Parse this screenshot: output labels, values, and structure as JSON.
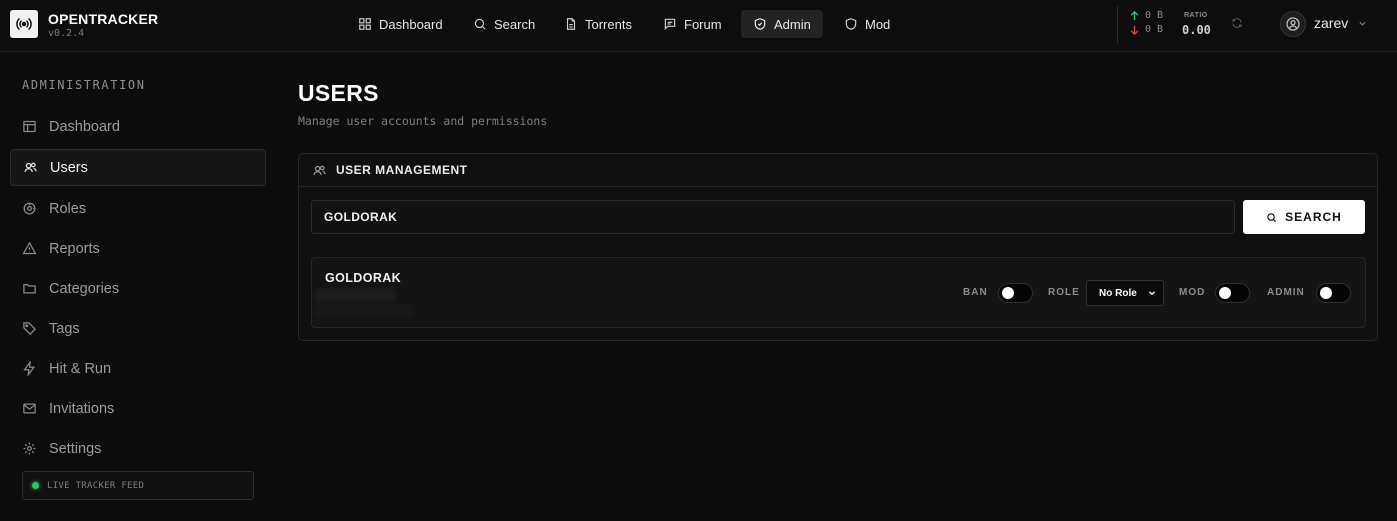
{
  "brand": {
    "name": "OPENTRACKER",
    "version": "v0.2.4"
  },
  "nav": {
    "dashboard": "Dashboard",
    "search": "Search",
    "torrents": "Torrents",
    "forum": "Forum",
    "admin": "Admin",
    "mod": "Mod"
  },
  "stats": {
    "upload": "0 B",
    "download": "0 B",
    "ratio_label": "RATIO",
    "ratio_value": "0.00"
  },
  "user": {
    "name": "zarev"
  },
  "sidebar": {
    "title": "ADMINISTRATION",
    "items": [
      {
        "label": "Dashboard",
        "icon": "layout-icon",
        "active": false
      },
      {
        "label": "Users",
        "icon": "users-icon",
        "active": true
      },
      {
        "label": "Roles",
        "icon": "badge-icon",
        "active": false
      },
      {
        "label": "Reports",
        "icon": "alert-icon",
        "active": false
      },
      {
        "label": "Categories",
        "icon": "folder-icon",
        "active": false
      },
      {
        "label": "Tags",
        "icon": "tag-icon",
        "active": false
      },
      {
        "label": "Hit & Run",
        "icon": "bolt-icon",
        "active": false
      },
      {
        "label": "Invitations",
        "icon": "mail-icon",
        "active": false
      },
      {
        "label": "Settings",
        "icon": "gear-icon",
        "active": false
      }
    ],
    "live_feed": "LIVE TRACKER FEED"
  },
  "page": {
    "title": "USERS",
    "subtitle": "Manage user accounts and permissions"
  },
  "panel": {
    "title": "USER MANAGEMENT",
    "search_value": "GOLDORAK",
    "search_button": "SEARCH",
    "result": {
      "username": "GOLDORAK",
      "ban_label": "BAN",
      "ban": false,
      "role_label": "ROLE",
      "role_value": "No Role",
      "mod_label": "MOD",
      "mod": false,
      "admin_label": "ADMIN",
      "admin": false
    }
  },
  "colors": {
    "background": "#0c0c0c",
    "accent_live": "#33c46a",
    "upload": "#33c46a",
    "download": "#e0464b"
  }
}
